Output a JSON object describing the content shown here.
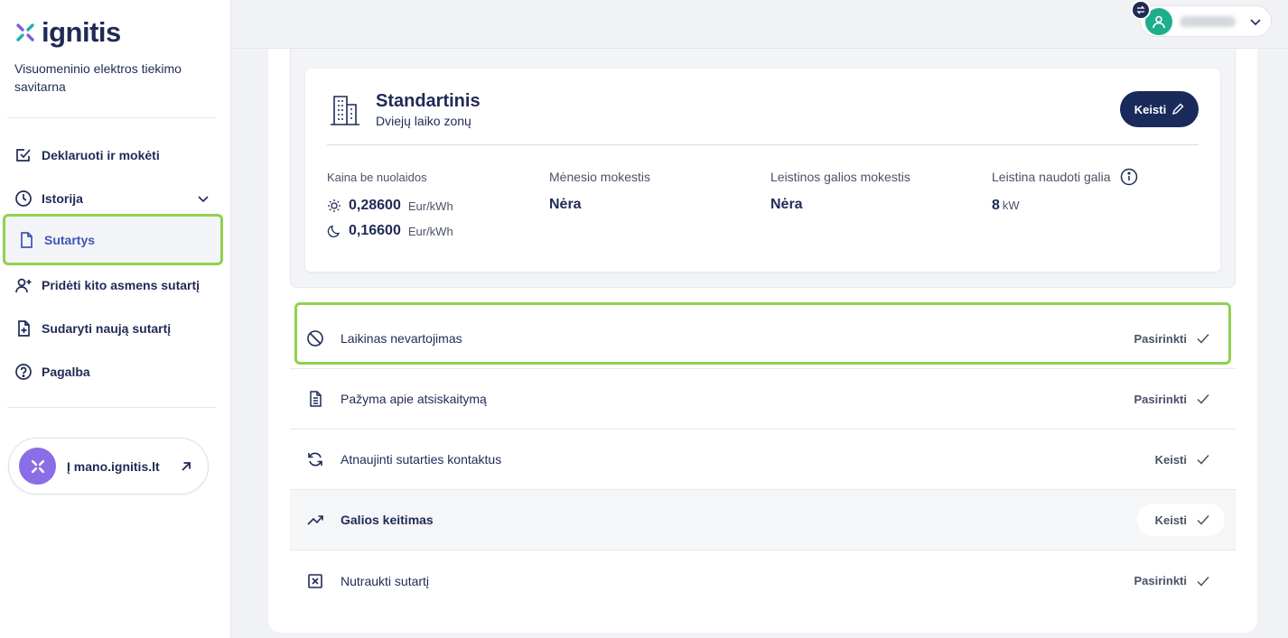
{
  "brand": {
    "name": "ignitis",
    "subtitle": "Visuomeninio elektros tiekimo savitarna",
    "accent": "#1f2a56",
    "highlight": "#8fd14f"
  },
  "sidebar": {
    "items": [
      {
        "label": "Deklaruoti ir mokėti",
        "icon": "checkbox-edit-icon"
      },
      {
        "label": "Istorija",
        "icon": "clock-icon"
      },
      {
        "label": "Sutartys",
        "icon": "document-icon"
      },
      {
        "label": "Pridėti kito asmens sutartį",
        "icon": "user-plus-icon"
      },
      {
        "label": "Sudaryti naują sutartį",
        "icon": "file-plus-icon"
      },
      {
        "label": "Pagalba",
        "icon": "help-icon"
      }
    ],
    "external_link": {
      "label": "Į mano.ignitis.lt",
      "icon": "arrow-up-right-icon"
    }
  },
  "header": {
    "user_menu": {
      "icon": "user-icon"
    }
  },
  "plan": {
    "title": "Standartinis",
    "subtitle": "Dviejų laiko zonų",
    "change_label": "Keisti",
    "columns": {
      "price": {
        "label": "Kaina be nuolaidos",
        "day_value": "0,28600",
        "night_value": "0,16600",
        "unit": "Eur/kWh"
      },
      "monthly_fee": {
        "label": "Mėnesio mokestis",
        "value": "Nėra"
      },
      "power_fee": {
        "label": "Leistinos galios mokestis",
        "value": "Nėra"
      },
      "allowed_power": {
        "label": "Leistina naudoti galia",
        "value": "8",
        "unit": "kW"
      }
    }
  },
  "options": [
    {
      "label": "Laikinas nevartojimas",
      "action": "Pasirinkti",
      "icon": "block-icon"
    },
    {
      "label": "Pažyma apie atsiskaitymą",
      "action": "Pasirinkti",
      "icon": "file-text-icon"
    },
    {
      "label": "Atnaujinti sutarties kontaktus",
      "action": "Keisti",
      "icon": "refresh-icon"
    },
    {
      "label": "Galios keitimas",
      "action": "Keisti",
      "icon": "trend-up-icon"
    },
    {
      "label": "Nutraukti sutartį",
      "action": "Pasirinkti",
      "icon": "close-box-icon"
    }
  ]
}
